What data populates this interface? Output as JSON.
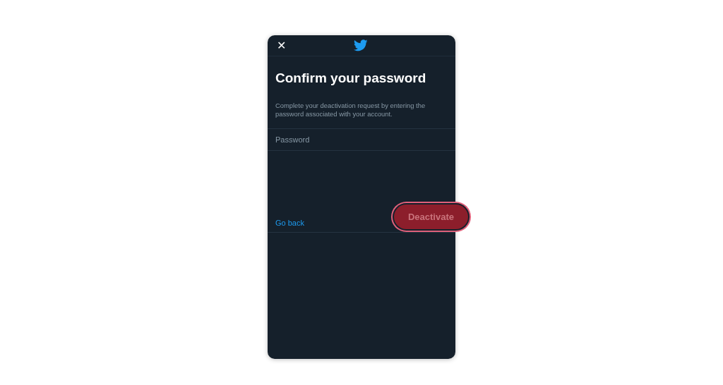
{
  "header": {
    "close": "✕"
  },
  "title": "Confirm your password",
  "description": "Complete your deactivation request by entering the password associated with your account.",
  "password_field": {
    "placeholder": "Password"
  },
  "footer": {
    "back_link": "Go back",
    "deactivate_button": {
      "label": "Deactivate",
      "disabled": true,
      "highlighted": true
    }
  }
}
